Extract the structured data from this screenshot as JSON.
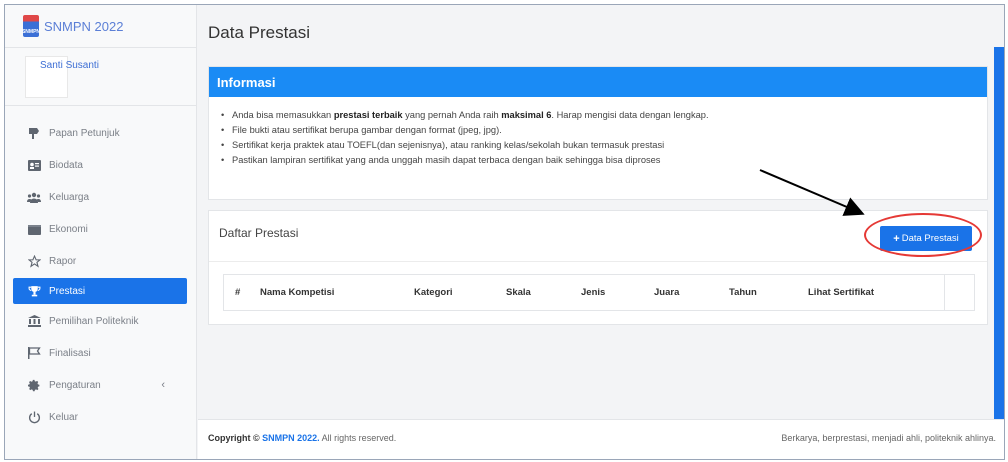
{
  "sidebar": {
    "brand": "SNMPN 2022",
    "logo_text": "SNMPN",
    "user_name": "Santi Susanti",
    "items": [
      {
        "label": "Papan Petunjuk",
        "icon": "signpost-icon"
      },
      {
        "label": "Biodata",
        "icon": "id-card-icon"
      },
      {
        "label": "Keluarga",
        "icon": "users-icon"
      },
      {
        "label": "Ekonomi",
        "icon": "wallet-icon"
      },
      {
        "label": "Rapor",
        "icon": "star-icon"
      },
      {
        "label": "Prestasi",
        "icon": "trophy-icon",
        "active": true
      },
      {
        "label": "Pemilihan Politeknik",
        "icon": "institution-icon"
      },
      {
        "label": "Finalisasi",
        "icon": "flag-icon"
      },
      {
        "label": "Pengaturan",
        "icon": "gear-icon",
        "caret": "‹"
      },
      {
        "label": "Keluar",
        "icon": "power-icon"
      }
    ]
  },
  "main": {
    "title": "Data Prestasi",
    "info": {
      "heading": "Informasi",
      "line1_a": "Anda bisa memasukkan ",
      "line1_b": "prestasi terbaik",
      "line1_c": " yang pernah Anda raih ",
      "line1_d": "maksimal 6",
      "line1_e": ". Harap mengisi data dengan lengkap.",
      "line2": "File bukti atau sertifikat berupa gambar dengan format (jpeg, jpg).",
      "line3": "Sertifikat kerja praktek atau TOEFL(dan sejenisnya), atau ranking kelas/sekolah bukan termasuk prestasi",
      "line4": "Pastikan lampiran sertifikat yang anda unggah masih dapat terbaca dengan baik sehingga bisa diproses"
    },
    "list": {
      "title": "Daftar Prestasi",
      "add_button": "Data Prestasi",
      "add_icon": "+",
      "columns": [
        "#",
        "Nama Kompetisi",
        "Kategori",
        "Skala",
        "Jenis",
        "Juara",
        "Tahun",
        "Lihat Sertifikat"
      ]
    }
  },
  "footer": {
    "copyright_prefix": "Copyright © ",
    "copyright_brand": "SNMPN 2022.",
    "copyright_suffix": " All rights reserved.",
    "tagline": "Berkarya, berprestasi, menjadi ahli, politeknik ahlinya."
  },
  "colors": {
    "primary": "#1a73e8",
    "info_header": "#1a8bf5",
    "annotation": "#e53935"
  }
}
